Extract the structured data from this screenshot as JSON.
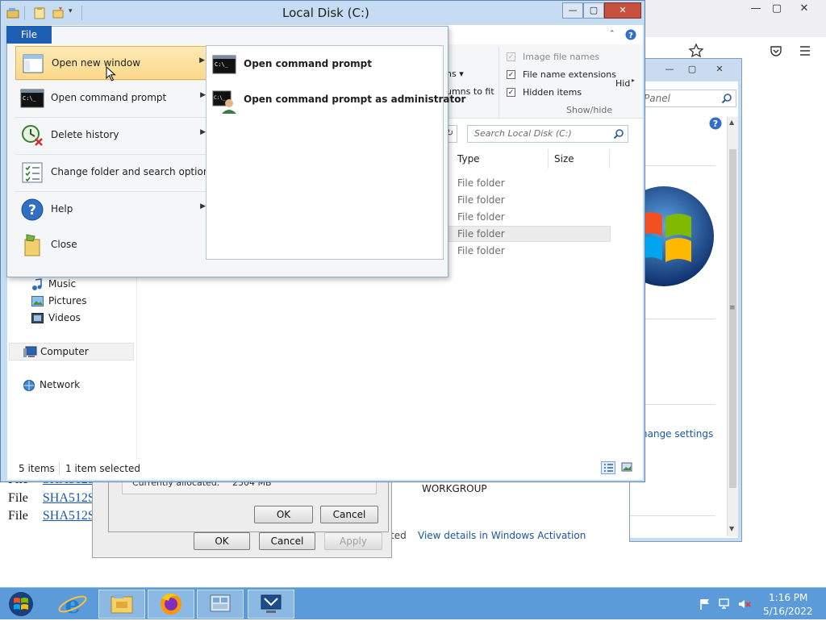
{
  "browser": {
    "caption_buttons": [
      "—",
      "▢",
      "✕"
    ],
    "toolbar_icons": [
      "star-icon",
      "pocket-icon",
      "hamburger-menu-icon"
    ]
  },
  "page_behind": {
    "rows": [
      {
        "label": "File",
        "link": "SHA512S"
      },
      {
        "label": "File",
        "link": "SHA512S"
      },
      {
        "label": "File",
        "link": "SHA512S"
      }
    ]
  },
  "dialogs": {
    "inner": {
      "allocated_label": "Currently allocated:",
      "allocated_value": "2304 MB",
      "ok": "OK",
      "cancel": "Cancel"
    },
    "outer": {
      "ok": "OK",
      "cancel": "Cancel",
      "apply": "Apply"
    }
  },
  "system_window": {
    "search_placeholder": "Panel",
    "change_settings": "hange settings",
    "workgroup": "WORKGROUP",
    "activation_prefix": "ted",
    "activation_link": "View details in Windows Activation"
  },
  "explorer": {
    "title": "Local Disk (C:)",
    "caption_buttons": [
      "—",
      "▢",
      "✕"
    ],
    "ribbon": {
      "options": [
        {
          "label": "Image file names",
          "checked": true,
          "disabled": true
        },
        {
          "label": "File name extensions",
          "checked": true,
          "disabled": false
        },
        {
          "label": "Hidden items",
          "checked": true,
          "disabled": false
        }
      ],
      "group_label": "Show/hide",
      "hide_label": "Hid",
      "cut_labels": [
        "ns ▾",
        "umns to fit"
      ]
    },
    "search_placeholder": "Search Local Disk (C:)",
    "columns": {
      "type": "Type",
      "size": "Size"
    },
    "rows": [
      {
        "type": "File folder",
        "selected": false
      },
      {
        "type": "File folder",
        "selected": false
      },
      {
        "type": "File folder",
        "selected": false
      },
      {
        "type": "File folder",
        "selected": true
      },
      {
        "type": "File folder",
        "selected": false
      }
    ],
    "nav": {
      "music": "Music",
      "pictures": "Pictures",
      "videos": "Videos",
      "computer": "Computer",
      "network": "Network"
    },
    "status": {
      "items": "5 items",
      "selected": "1 item selected"
    }
  },
  "file_menu": {
    "tab": "File",
    "items": [
      {
        "label": "Open new window",
        "submenu": true,
        "highlighted": true,
        "icon": "window-icon"
      },
      {
        "label": "Open command prompt",
        "submenu": true,
        "icon": "command-prompt-icon"
      },
      {
        "label": "Delete history",
        "submenu": true,
        "icon": "delete-history-icon"
      },
      {
        "label": "Change folder and search options",
        "submenu": false,
        "icon": "folder-options-icon"
      },
      {
        "label": "Help",
        "submenu": true,
        "icon": "help-icon"
      },
      {
        "label": "Close",
        "submenu": false,
        "icon": "close-folder-icon"
      }
    ],
    "submenu": [
      {
        "label": "Open command prompt",
        "icon": "command-prompt-icon"
      },
      {
        "label": "Open command prompt as administrator",
        "icon": "admin-command-prompt-icon"
      }
    ]
  },
  "taskbar": {
    "apps": [
      "start-button",
      "internet-explorer-icon",
      "file-explorer-icon",
      "firefox-icon",
      "server-manager-icon",
      "remote-desktop-icon"
    ],
    "time": "1:16 PM",
    "date": "5/16/2022"
  },
  "colors": {
    "accent": "#1c5fb4",
    "taskbar": "#5b9bd9",
    "window_frame": "#c6dcf2",
    "menu_highlight": "#fbd98a"
  }
}
